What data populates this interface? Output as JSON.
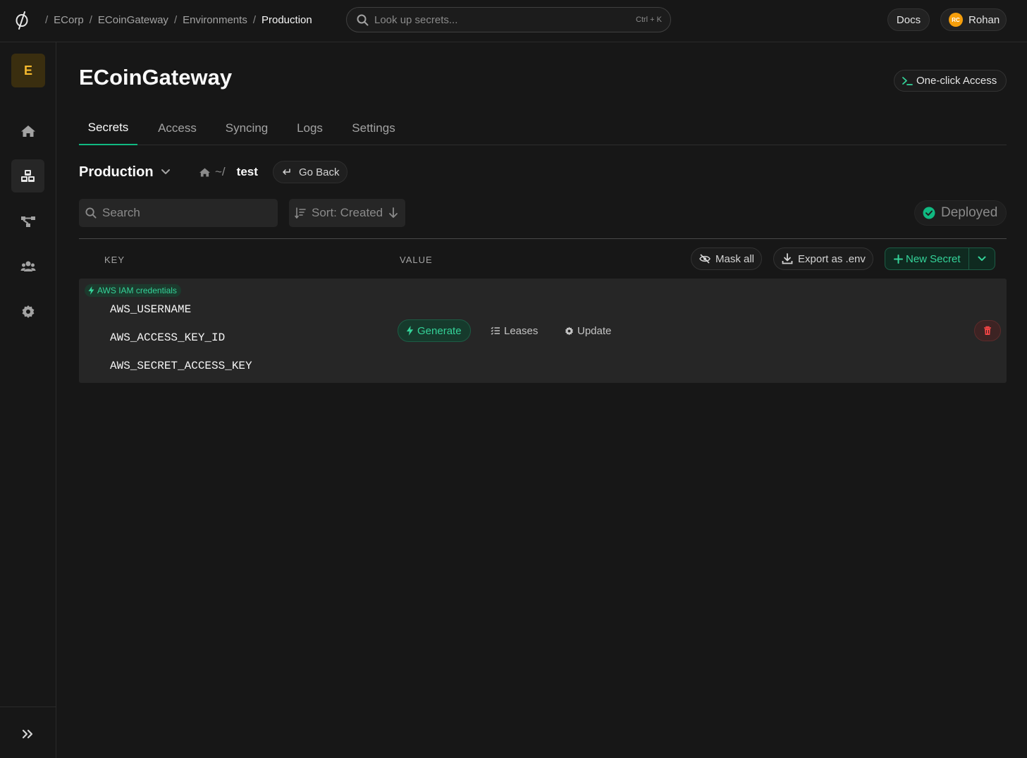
{
  "breadcrumb": {
    "items": [
      "ECorp",
      "ECoinGateway",
      "Environments",
      "Production"
    ]
  },
  "lookup": {
    "placeholder": "Look up secrets...",
    "shortcut": "Ctrl + K"
  },
  "header": {
    "docs_label": "Docs",
    "user_initials": "RC",
    "user_name": "Rohan"
  },
  "sidebar": {
    "org_initial": "E",
    "items": [
      {
        "icon": "home-icon",
        "active": false
      },
      {
        "icon": "apps-icon",
        "active": true
      },
      {
        "icon": "integrations-icon",
        "active": false
      },
      {
        "icon": "members-icon",
        "active": false
      },
      {
        "icon": "settings-icon",
        "active": false
      }
    ],
    "expand_icon": "chevrons-right-icon"
  },
  "page": {
    "title": "ECoinGateway",
    "one_click_label": "One-click Access",
    "tabs": [
      {
        "label": "Secrets",
        "active": true
      },
      {
        "label": "Access",
        "active": false
      },
      {
        "label": "Syncing",
        "active": false
      },
      {
        "label": "Logs",
        "active": false
      },
      {
        "label": "Settings",
        "active": false
      }
    ]
  },
  "env": {
    "name": "Production",
    "path_prefix": "~/",
    "folder": "test",
    "go_back_label": "Go Back"
  },
  "toolbar": {
    "search_placeholder": "Search",
    "sort_label": "Sort: Created",
    "status_label": "Deployed"
  },
  "table": {
    "key_header": "KEY",
    "value_header": "VALUE",
    "mask_all_label": "Mask all",
    "export_label": "Export as .env",
    "new_secret_label": "New Secret"
  },
  "dynamic_secret": {
    "tag": "AWS IAM credentials",
    "keys": [
      "AWS_USERNAME",
      "AWS_ACCESS_KEY_ID",
      "AWS_SECRET_ACCESS_KEY"
    ],
    "generate_label": "Generate",
    "leases_label": "Leases",
    "update_label": "Update"
  },
  "colors": {
    "accent": "#10b981",
    "accent_text": "#34d399",
    "background": "#171717",
    "danger": "#ef4444",
    "org_badge": "#f5b92e"
  }
}
